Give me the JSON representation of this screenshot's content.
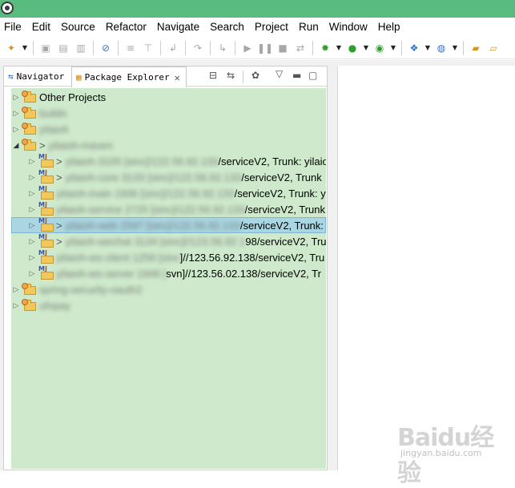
{
  "menubar": {
    "items": [
      "File",
      "Edit",
      "Source",
      "Refactor",
      "Navigate",
      "Search",
      "Project",
      "Run",
      "Window",
      "Help"
    ]
  },
  "tabs": {
    "navigator": "Navigator",
    "package_explorer": "Package Explorer"
  },
  "tree": {
    "rows": [
      {
        "label": "Other Projects",
        "suffix": ""
      },
      {
        "label": "buildn",
        "suffix": ""
      },
      {
        "label": "yilaioh",
        "suffix": ""
      },
      {
        "label": "yilaioh-maven",
        "suffix": ""
      },
      {
        "label": "yilaioh-3105 [sinc]/122.56.92.133",
        "suffix": "/serviceV2, Trunk: yilaio"
      },
      {
        "label": "yilaioh-core 3133 [sinc]/122.56.92.133",
        "suffix": "/serviceV2, Trunk"
      },
      {
        "label": "yilaioh-main 1936 [sinc]/122.56.92.133",
        "suffix": "/serviceV2, Trunk: y"
      },
      {
        "label": "yilaioh-service 2725 [sinc]/122.56.92.133",
        "suffix": "/serviceV2, Trunk"
      },
      {
        "label": "yilaioh-web 2597 [sinc]/122.56.92.133",
        "suffix": "/serviceV2, Trunk:"
      },
      {
        "label": "yilaioh-wechat 3134 [sinc]//123.56.92.1",
        "suffix": "98/serviceV2, Tru"
      },
      {
        "label": "yilaioh-ws-client 1259 [sinc",
        "suffix": "]//123.56.92.138/serviceV2, Tru"
      },
      {
        "label": "yilaioh-ws-server 1946 [",
        "suffix": "svn]//123.56.02.138/serviceV2, Tr"
      },
      {
        "label": "spring-security-oauth2",
        "suffix": ""
      },
      {
        "label": "ufopay",
        "suffix": ""
      }
    ]
  },
  "watermark": {
    "brand": "Baidu经验",
    "url": "jingyan.baidu.com"
  },
  "colors": {
    "titlebar": "#59bb7d",
    "tree_background": "#cee9cb",
    "selection": "#a9d6e2"
  }
}
